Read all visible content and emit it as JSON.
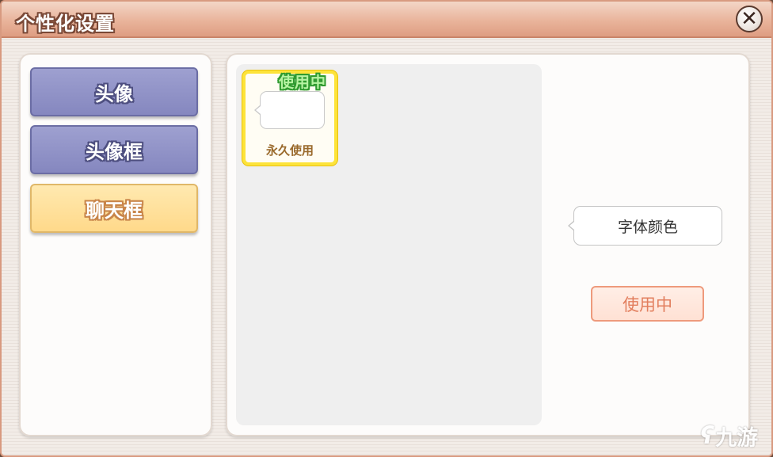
{
  "window": {
    "title": "个性化设置",
    "close_glyph": "✕",
    "close_icon": "close-icon"
  },
  "sidebar": {
    "tabs": [
      {
        "label": "头像",
        "state": "normal"
      },
      {
        "label": "头像框",
        "state": "normal"
      },
      {
        "label": "聊天框",
        "state": "selected"
      }
    ]
  },
  "items": [
    {
      "label": "永久使用",
      "badge": "使用中",
      "selected": true
    }
  ],
  "preview": {
    "bubble_text": "字体颜色",
    "use_button_label": "使用中"
  },
  "watermark": {
    "icon": "九游-logo-icon",
    "text": "九游"
  },
  "colors": {
    "title_bar": "#e9b49b",
    "tab_normal": "#8587bf",
    "tab_selected": "#ffd98a",
    "item_highlight": "#fde33a",
    "in_use_green": "#2f9a2f",
    "use_button_accent": "#ee9a7c"
  }
}
